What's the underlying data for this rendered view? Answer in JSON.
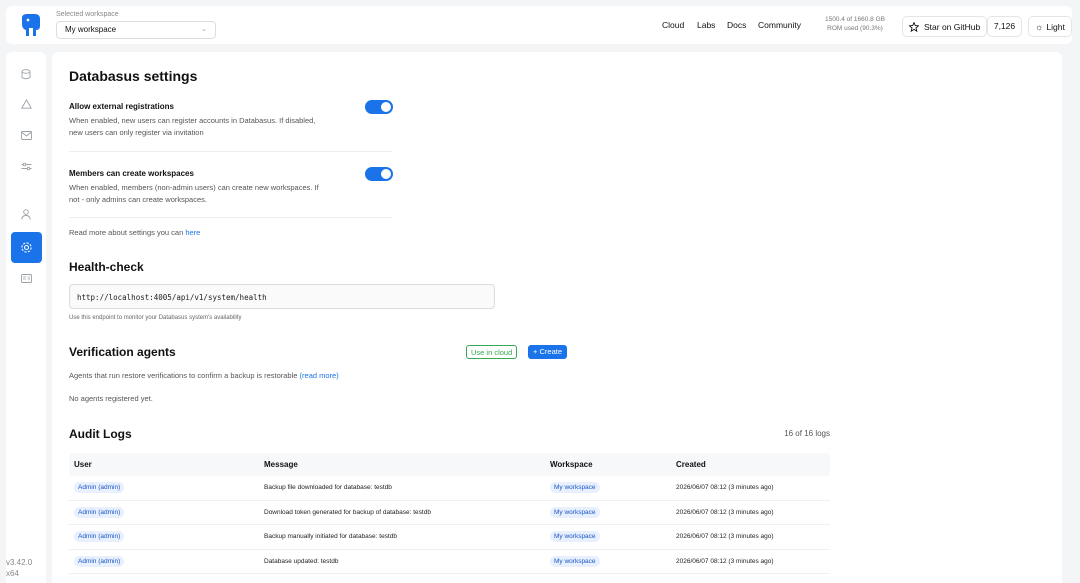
{
  "header": {
    "workspace_label": "Selected workspace",
    "workspace_value": "My workspace",
    "nav": [
      "Cloud",
      "Labs",
      "Docs",
      "Community"
    ],
    "rom_line1": "1500.4 of 1660.8 GB",
    "rom_line2": "ROM used (90.3%)",
    "github_label": "Star on GitHub",
    "github_count": "7,126",
    "theme_label": "Light"
  },
  "sidebar": {
    "icons": [
      "database-icon",
      "warning-icon",
      "mail-icon",
      "sliders-icon",
      "user-icon",
      "settings-icon",
      "id-card-icon"
    ],
    "version": "v3.42.0",
    "arch": "x64"
  },
  "settings": {
    "title": "Databasus settings",
    "external_title": "Allow external registrations",
    "external_desc": "When enabled, new users can register accounts in Databasus. If disabled, new users can only register via invitation",
    "members_title": "Members can create workspaces",
    "members_desc": "When enabled, members (non-admin users) can create new workspaces. If not - only admins can create workspaces.",
    "read_more_prefix": "Read more about settings you can",
    "read_more_link": "here"
  },
  "health": {
    "title": "Health-check",
    "endpoint": "http://localhost:4005/api/v1/system/health",
    "hint": "Use this endpoint to monitor your Databasus system's availability"
  },
  "agents": {
    "title": "Verification agents",
    "use_cloud": "Use in cloud",
    "create": "Create",
    "desc": "Agents that run restore verifications to confirm a backup is restorable",
    "desc_link": "(read more)",
    "empty": "No agents registered yet."
  },
  "audit": {
    "title": "Audit Logs",
    "count": "16 of 16 logs",
    "headers": [
      "User",
      "Message",
      "Workspace",
      "Created"
    ],
    "rows": [
      {
        "user": "Admin (admin)",
        "message": "Backup file downloaded for database: testdb",
        "workspace": "My workspace",
        "created": "2026/06/07 08:12 (3 minutes ago)"
      },
      {
        "user": "Admin (admin)",
        "message": "Download token generated for backup of database: testdb",
        "workspace": "My workspace",
        "created": "2026/06/07 08:12 (3 minutes ago)"
      },
      {
        "user": "Admin (admin)",
        "message": "Backup manually initiated for database: testdb",
        "workspace": "My workspace",
        "created": "2026/06/07 08:12 (3 minutes ago)"
      },
      {
        "user": "Admin (admin)",
        "message": "Database updated: testdb",
        "workspace": "My workspace",
        "created": "2026/06/07 08:12 (3 minutes ago)"
      }
    ]
  },
  "colors": {
    "accent": "#1a73e8",
    "success": "#34a853"
  }
}
